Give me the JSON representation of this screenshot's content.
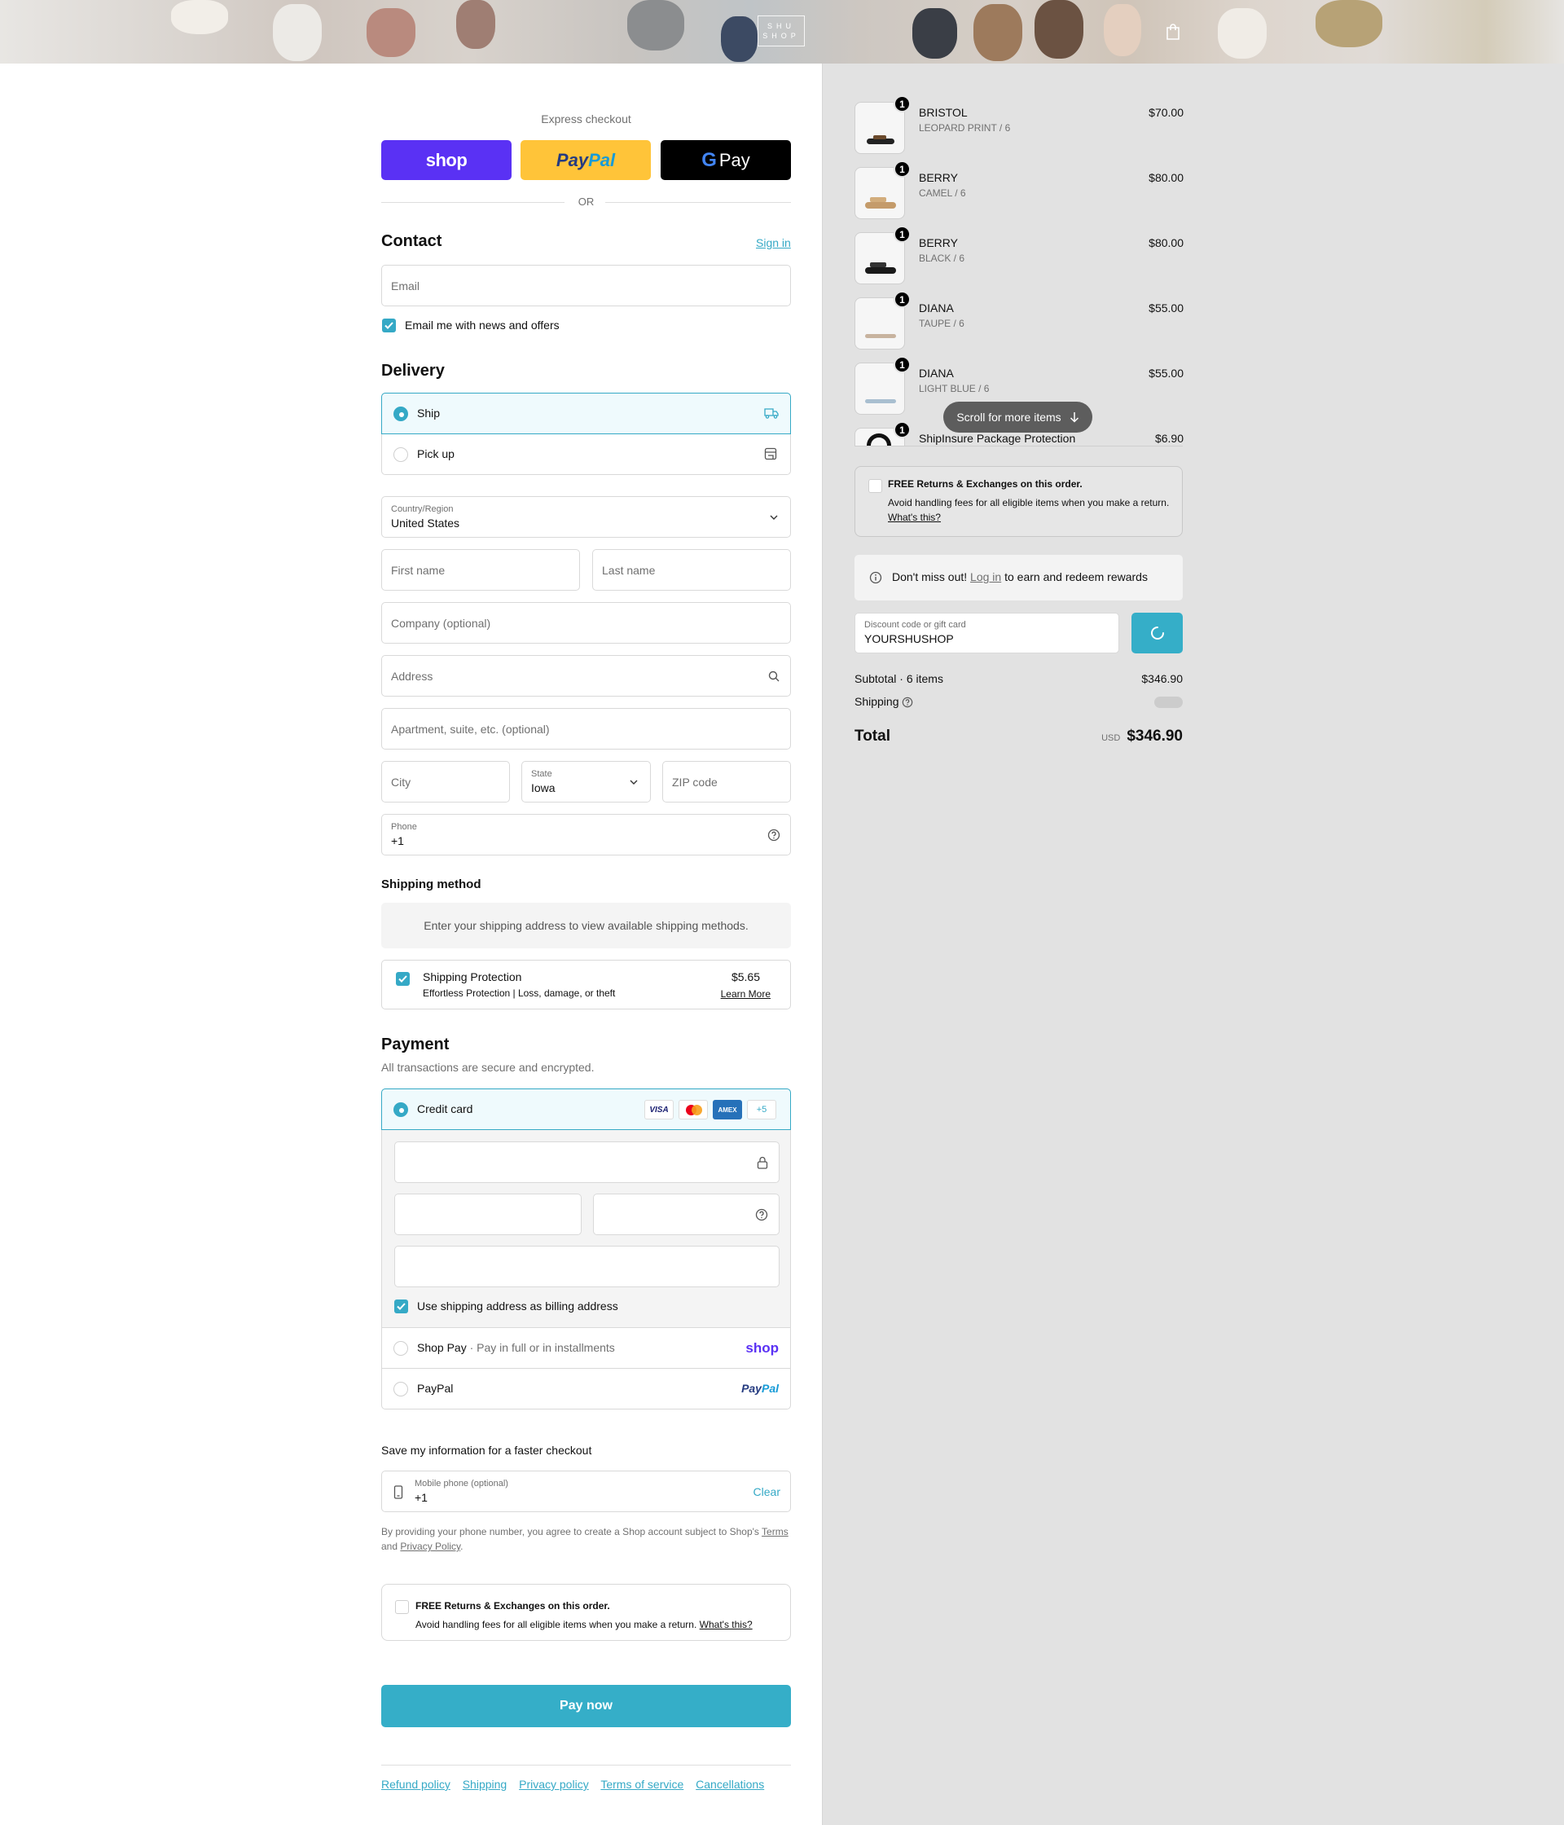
{
  "colors": {
    "accent": "#35aec8",
    "shop_purple": "#5a31f4",
    "paypal_yellow": "#ffc439",
    "summary_bg": "#e2e2e2"
  },
  "header": {
    "logo_line1": "SHU",
    "logo_line2": "SHOP",
    "cart_icon": "shopping-bag-icon"
  },
  "express": {
    "title": "Express checkout",
    "shop_label": "shop",
    "paypal_label": "PayPal",
    "gpay_label": "Pay",
    "or_label": "OR"
  },
  "contact": {
    "heading": "Contact",
    "sign_in": "Sign in",
    "email_placeholder": "Email",
    "news_label": "Email me with news and offers",
    "news_checked": true
  },
  "delivery": {
    "heading": "Delivery",
    "options": [
      {
        "label": "Ship",
        "selected": true,
        "icon": "truck-icon"
      },
      {
        "label": "Pick up",
        "selected": false,
        "icon": "store-icon"
      }
    ],
    "country_label": "Country/Region",
    "country_value": "United States",
    "first_name_ph": "First name",
    "last_name_ph": "Last name",
    "company_ph": "Company (optional)",
    "address_ph": "Address",
    "apartment_ph": "Apartment, suite, etc. (optional)",
    "city_ph": "City",
    "state_label": "State",
    "state_value": "Iowa",
    "zip_ph": "ZIP code",
    "phone_label": "Phone",
    "phone_value": "+1"
  },
  "shipping_method": {
    "heading": "Shipping method",
    "notice": "Enter your shipping address to view available shipping methods."
  },
  "protection": {
    "title": "Shipping Protection",
    "subtitle": "Effortless Protection | Loss, damage, or theft",
    "price": "$5.65",
    "learn_more": "Learn More",
    "checked": true
  },
  "payment": {
    "heading": "Payment",
    "subheading": "All transactions are secure and encrypted.",
    "credit_card_label": "Credit card",
    "card_brands": [
      "VISA",
      "Mastercard",
      "AMEX"
    ],
    "more_brands": "+5",
    "billing_label": "Use shipping address as billing address",
    "shoppay_label": "Shop Pay",
    "shoppay_note": "Pay in full or in installments",
    "shoppay_logo": "shop",
    "paypal_label": "PayPal",
    "paypal_logo": "PayPal"
  },
  "save_info": {
    "heading": "Save my information for a faster checkout",
    "mobile_label": "Mobile phone (optional)",
    "mobile_value": "+1",
    "clear": "Clear",
    "legal_prefix": "By providing your phone number, you agree to create a Shop account subject to Shop's",
    "terms": "Terms",
    "and": "and",
    "privacy": "Privacy Policy",
    "period": "."
  },
  "free_returns": {
    "title": "FREE Returns & Exchanges on this order.",
    "body": "Avoid handling fees for all eligible items when you make a return.",
    "whats_this": "What's this?"
  },
  "pay_now": "Pay now",
  "footer_links": [
    "Refund policy",
    "Shipping",
    "Privacy policy",
    "Terms of service",
    "Cancellations"
  ],
  "summary": {
    "items": [
      {
        "name": "BRISTOL",
        "variant": "LEOPARD PRINT / 6",
        "price": "$70.00",
        "qty": "1"
      },
      {
        "name": "BERRY",
        "variant": "CAMEL / 6",
        "price": "$80.00",
        "qty": "1"
      },
      {
        "name": "BERRY",
        "variant": "BLACK / 6",
        "price": "$80.00",
        "qty": "1"
      },
      {
        "name": "DIANA",
        "variant": "TAUPE / 6",
        "price": "$55.00",
        "qty": "1"
      },
      {
        "name": "DIANA",
        "variant": "LIGHT BLUE / 6",
        "price": "$55.00",
        "qty": "1"
      },
      {
        "name": "ShipInsure Package Protection",
        "variant": "",
        "price": "$6.90",
        "qty": "1"
      }
    ],
    "scroll_label": "Scroll for more items",
    "rewards_prefix": "Don't miss out!",
    "rewards_link": "Log in",
    "rewards_suffix": "to earn and redeem rewards",
    "discount_label": "Discount code or gift card",
    "discount_value": "YOURSHUSHOP",
    "subtotal_label": "Subtotal · 6 items",
    "subtotal_value": "$346.90",
    "shipping_label": "Shipping",
    "total_label": "Total",
    "currency": "USD",
    "total_value": "$346.90"
  }
}
